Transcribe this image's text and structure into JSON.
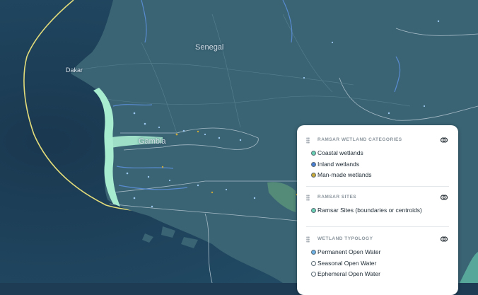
{
  "map": {
    "labels": {
      "dakar": "Dakar",
      "senegal": "Senegal",
      "gambia": "Gambia"
    },
    "colors": {
      "ocean_deep": "#1b3a52",
      "ocean": "#234a63",
      "land": "#3a6272",
      "boundary": "#9fb3bf",
      "eez_line": "#e8e07a",
      "coastal_wetland": "#a8ecd0"
    }
  },
  "legend": {
    "sections": [
      {
        "title": "RAMSAR WETLAND CATEGORIES",
        "items": [
          {
            "label": "Coastal wetlands",
            "color": "#6bd3b5"
          },
          {
            "label": "Inland wetlands",
            "color": "#4a7fd6"
          },
          {
            "label": "Man-made wetlands",
            "color": "#c8a93a"
          }
        ]
      },
      {
        "title": "RAMSAR SITES",
        "items": [
          {
            "label": "Ramsar Sites (boundaries or centroids)",
            "color": "#6bd3b5"
          }
        ]
      },
      {
        "title": "WETLAND TYPOLOGY",
        "items": [
          {
            "label": "Permanent Open Water",
            "color": "#6fb3e8"
          },
          {
            "label": "Seasonal Open Water",
            "color": "#ffffff"
          },
          {
            "label": "Ephemeral Open Water",
            "color": "#ffffff"
          }
        ]
      }
    ]
  }
}
